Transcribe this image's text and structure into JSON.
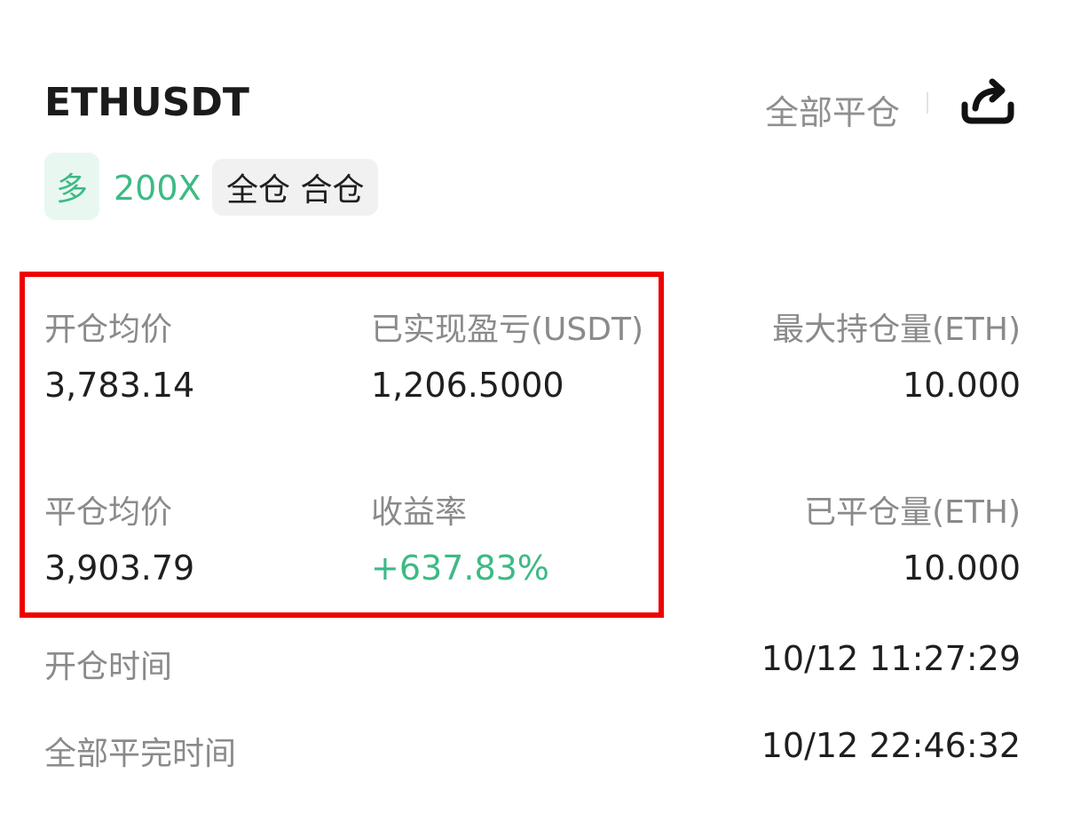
{
  "header": {
    "symbol": "ETHUSDT",
    "close_all_label": "全部平仓",
    "share_icon": "share-icon"
  },
  "tags": {
    "side": "多",
    "leverage": "200X",
    "margin_mode": "全仓 合仓"
  },
  "stats": {
    "open_avg_label": "开仓均价",
    "open_avg_value": "3,783.14",
    "realized_pnl_label": "已实现盈亏(USDT)",
    "realized_pnl_value": "1,206.5000",
    "max_position_label": "最大持仓量(ETH)",
    "max_position_value": "10.000",
    "close_avg_label": "平仓均价",
    "close_avg_value": "3,903.79",
    "roi_label": "收益率",
    "roi_value": "+637.83%",
    "closed_qty_label": "已平仓量(ETH)",
    "closed_qty_value": "10.000"
  },
  "times": {
    "open_time_label": "开仓时间",
    "open_time_value": "10/12 11:27:29",
    "close_time_label": "全部平完时间",
    "close_time_value": "10/12 22:46:32"
  },
  "colors": {
    "profit_green": "#3dba84",
    "highlight_red": "#ee0000",
    "label_gray": "#8a8a8a"
  }
}
